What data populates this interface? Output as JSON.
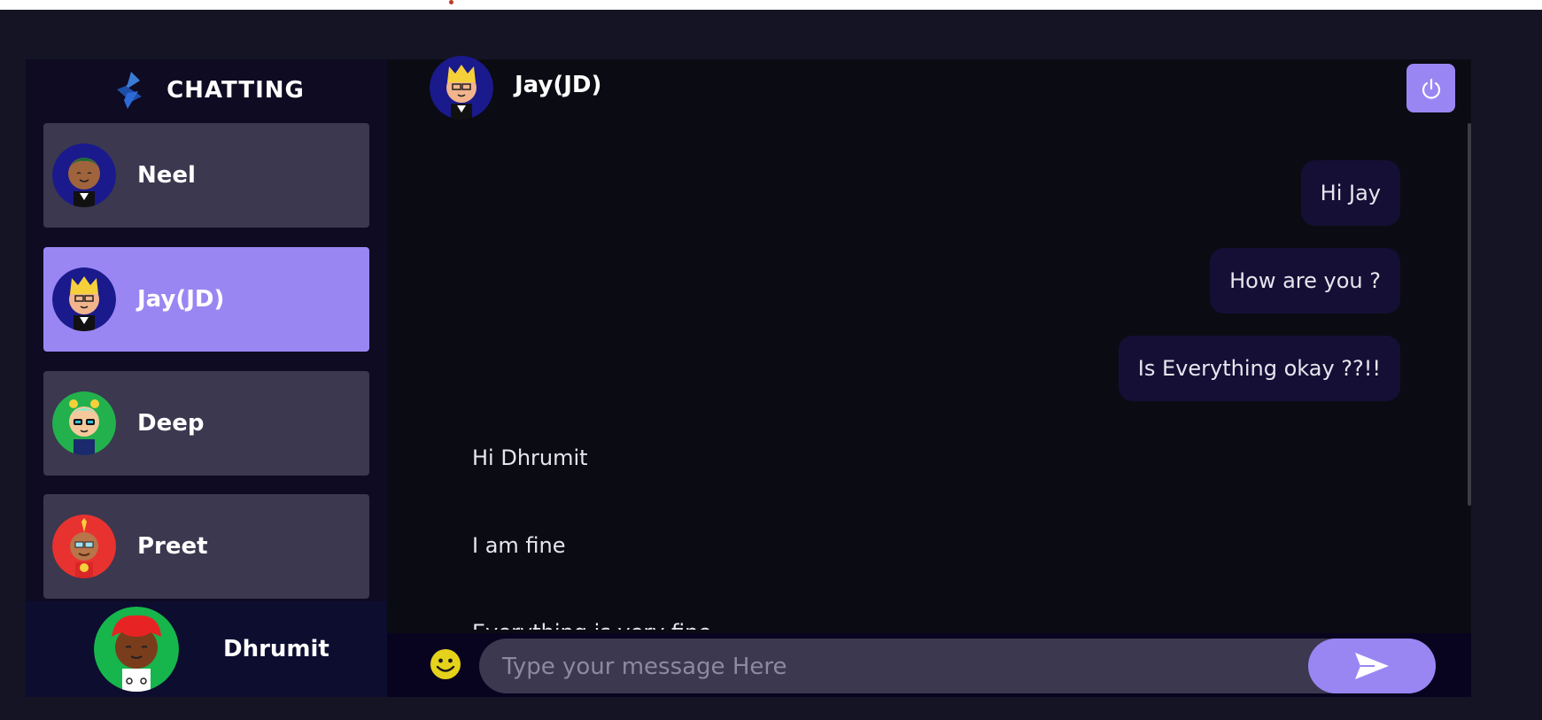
{
  "brand": {
    "title": "CHATTING"
  },
  "contacts": [
    {
      "name": "Neel",
      "active": false
    },
    {
      "name": "Jay(JD)",
      "active": true
    },
    {
      "name": "Deep",
      "active": false
    },
    {
      "name": "Preet",
      "active": false
    }
  ],
  "current_user": {
    "name": "Dhrumit"
  },
  "chat": {
    "header_name": "Jay(JD)",
    "messages": [
      {
        "text": "Hi Jay",
        "type": "sent"
      },
      {
        "text": "How are you ?",
        "type": "sent"
      },
      {
        "text": "Is Everything okay ??!!",
        "type": "sent"
      },
      {
        "text": "Hi Dhrumit",
        "type": "received"
      },
      {
        "text": "I am fine",
        "type": "received"
      },
      {
        "text": "Everything is very fine",
        "type": "received"
      }
    ],
    "input_placeholder": "Type your message Here"
  },
  "icons": {
    "logout": "power-icon",
    "emoji": "smiley-icon",
    "send": "send-arrow-icon",
    "brand": "logo-icon"
  },
  "colors": {
    "accent": "#9a86f3",
    "sent_bubble": "#150f36",
    "card": "#3b3850",
    "sidebar": "#0e0b22"
  }
}
